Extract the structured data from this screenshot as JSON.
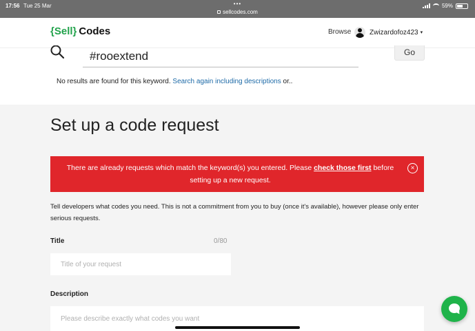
{
  "status_bar": {
    "time": "17:56",
    "date": "Tue 25 Mar",
    "dots": "•••",
    "url": "sellcodes.com",
    "battery": "59%",
    "battery_level": 0.59
  },
  "header": {
    "logo_open_brace": "{",
    "logo_sell": "Sell",
    "logo_close_brace": "}",
    "logo_codes": "Codes",
    "browse_label": "Browse",
    "username": "Zwizardofoz423",
    "caret": "▾"
  },
  "search": {
    "query": "#rooextend",
    "go_label": "Go",
    "no_results_text": "No results are found for this keyword.",
    "search_again_link": "Search again including descriptions",
    "suffix": "or.."
  },
  "main": {
    "title": "Set up a code request",
    "alert": {
      "text_before": "There are already requests which match the keyword(s) you entered. Please",
      "link": "check those first",
      "text_after": "before setting up a new request.",
      "close_glyph": "×"
    },
    "intro": "Tell developers what codes you need. This is not a commitment from you to buy (once it's available), however please only enter serious requests.",
    "title_field": {
      "label": "Title",
      "counter": "0/80",
      "placeholder": "Title of your request"
    },
    "description_field": {
      "label": "Description",
      "placeholder": "Please describe exactly what codes you want"
    }
  },
  "colors": {
    "brand_green": "#21a24b",
    "alert_red": "#e0262b",
    "link_blue": "#1d6aa7",
    "chat_green": "#1fb34a"
  },
  "icons": [
    "lock-icon",
    "signal-icon",
    "wifi-icon",
    "battery-icon",
    "search-icon",
    "close-circle-icon",
    "chat-icon",
    "avatar-icon",
    "chevron-down-icon"
  ]
}
